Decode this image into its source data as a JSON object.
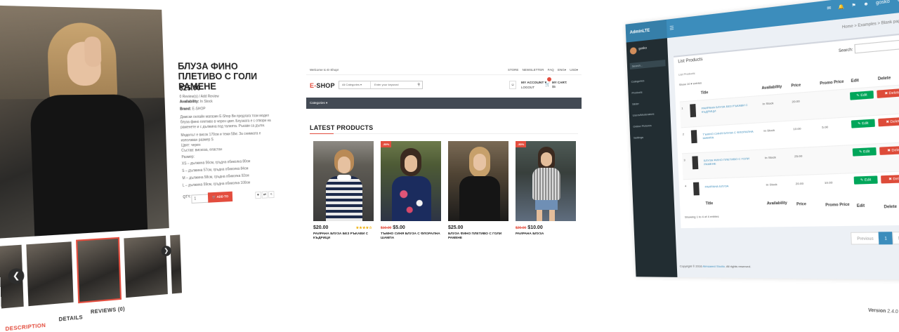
{
  "left": {
    "title": "БЛУЗА ФИНО ПЛЕТИВО С ГОЛИ РАМЕНЕ",
    "price": "$25.00",
    "reviews": "0 Review(s) / Add Review",
    "availability_label": "Availability:",
    "availability_value": "In Stock",
    "brand_label": "Brand:",
    "brand_value": "E-SHOP",
    "desc1": "Дамски онлайн магазин E-Shop Ви предлага този модел блуза фино плетиво в черен цвят. Блузката е с отвори на раменете и с дължина под талията. Ръкави са дълги.",
    "desc2": "Моделът е висок 170см и тежи 58кг. За снимката е използван размер S",
    "desc3": "Цвят: черен",
    "desc4": "Състав: вискоза, еластан",
    "size_label": "Размер:",
    "sizes": [
      "XS – дължина 56см, гръдна обиколка 80см",
      "S – дължина 57см, гръдна обиколка 84см",
      "M – дължина 58см, гръдна обиколка 92см",
      "L – дължина 59см, гръдна обиколка 100см"
    ],
    "qty_label": "QTY:",
    "qty_value": "1",
    "add_to_cart": "ADD TO CART",
    "tabs": [
      "DESCRIPTION",
      "DETAILS",
      "REVIEWS (0)"
    ]
  },
  "center": {
    "welcome": "Welcome to E-Shop!",
    "top_links": [
      "STORE",
      "NEWSLETTER",
      "FAQ",
      "ENG▾",
      "USD▾"
    ],
    "logo_e": "E-",
    "logo_shop": "SHOP",
    "category_select": "All Categories",
    "search_placeholder": "Enter your keyword",
    "my_account": "MY ACCOUNT ▾",
    "logout": "LOGOUT",
    "my_cart": "MY CART:",
    "cart_total": "$5",
    "categories": "Categories ▾",
    "section_title": "LATEST PRODUCTS",
    "products": [
      {
        "sale": "",
        "old": "",
        "price": "$20.00",
        "stars": "★★★★☆",
        "name": "РАИРАНА БЛУЗА БЕЗ РЪКАВИ С КЪДРИЦИ"
      },
      {
        "sale": "-50%",
        "old": "$10.00",
        "price": "$5.00",
        "stars": "",
        "name": "ТЪМНО СИНЯ БЛУЗА С ФЛОРАЛНА ШАМПА"
      },
      {
        "sale": "",
        "old": "",
        "price": "$25.00",
        "stars": "",
        "name": "БЛУЗА ФИНО ПЛЕТИВО С ГОЛИ РАМЕНЕ"
      },
      {
        "sale": "-50%",
        "old": "$20.00",
        "price": "$10.00",
        "stars": "",
        "name": "РАИРАНА БЛУЗА"
      }
    ]
  },
  "right": {
    "logo": "AdminLTE",
    "user": "gosko",
    "breadcrumb": "Home > Examples > Blank page",
    "page_title": "List Products",
    "box_subtitle": "List Products",
    "search_label": "Search:",
    "show_entries": "Show 10 ▾ entries",
    "headers": [
      "Title",
      "Availability",
      "Price",
      "Promo Price",
      "Edit",
      "Delete"
    ],
    "rows": [
      {
        "num": "1",
        "title": "РАИРАНА БЛУЗА БЕЗ РЪКАВИ С КЪДРИЦИ",
        "avail": "In Stock",
        "price": "20.00",
        "promo": ""
      },
      {
        "num": "2",
        "title": "ТЪМНО СИНЯ БЛУЗА С ФЛОРАЛНА ШАМПА",
        "avail": "In Stock",
        "price": "10.00",
        "promo": "5.00"
      },
      {
        "num": "3",
        "title": "БЛУЗА ФИНО ПЛЕТИВО С ГОЛИ РАМЕНЕ",
        "avail": "In Stock",
        "price": "25.00",
        "promo": ""
      },
      {
        "num": "4",
        "title": "РАИРАНА БЛУЗА",
        "avail": "In Stock",
        "price": "20.00",
        "promo": "10.00"
      }
    ],
    "edit_label": "✎ Edit",
    "delete_label": "✖ Delete",
    "showing": "Showing 1 to 4 of 4 entries",
    "pagination": [
      "Previous",
      "1",
      "Next"
    ],
    "copyright_pre": "Copyright © 2016 ",
    "copyright_link": "Almsaeed Studio",
    "copyright_post": ". All rights reserved.",
    "version_label": "Version",
    "version_value": "2.4.0",
    "sidebar_items": [
      "Categories",
      "Products",
      "Slider",
      "Users/Moderators",
      "Online Pictures",
      "Settings"
    ],
    "sidebar_search": "Search..."
  }
}
